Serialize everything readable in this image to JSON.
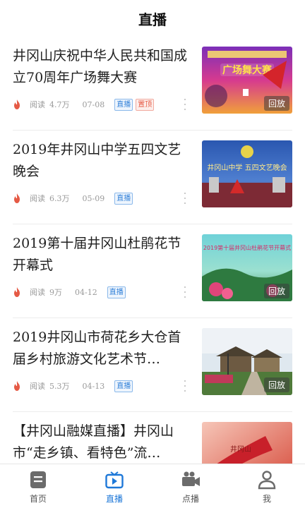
{
  "header": {
    "title": "直播"
  },
  "meta_labels": {
    "read": "阅读",
    "live_badge": "直播",
    "top_badge": "置顶",
    "replay": "回放"
  },
  "items": [
    {
      "title": "井冈山庆祝中华人民共和国成立70周年广场舞大赛",
      "reads": "4.7万",
      "date": "07-08",
      "pinned": true,
      "thumb_text": "广场舞大赛"
    },
    {
      "title": "2019年井冈山中学五四文艺晚会",
      "reads": "6.3万",
      "date": "05-09",
      "pinned": false,
      "thumb_text": "井冈山中学 五四文艺晚会"
    },
    {
      "title": "2019第十届井冈山杜鹃花节开幕式",
      "reads": "9万",
      "date": "04-12",
      "pinned": false,
      "thumb_text": "2019第十届井冈山杜鹃花节开幕式"
    },
    {
      "title": "2019井冈山市荷花乡大仓首届乡村旅游文化艺术节…",
      "reads": "5.3万",
      "date": "04-13",
      "pinned": false
    },
    {
      "title": "【井冈山融媒直播】井冈山市“走乡镇、看特色”流…",
      "reads": "",
      "date": "",
      "pinned": false,
      "thumb_text": "井冈山"
    }
  ],
  "tabs": [
    {
      "label": "首页",
      "icon": "home-icon",
      "active": false
    },
    {
      "label": "直播",
      "icon": "tv-live-icon",
      "active": true
    },
    {
      "label": "点播",
      "icon": "video-camera-icon",
      "active": false
    },
    {
      "label": "我",
      "icon": "user-icon",
      "active": false
    }
  ],
  "colors": {
    "accent": "#1e78d8",
    "top_badge": "#e55a45",
    "fire": "#e55a45"
  }
}
